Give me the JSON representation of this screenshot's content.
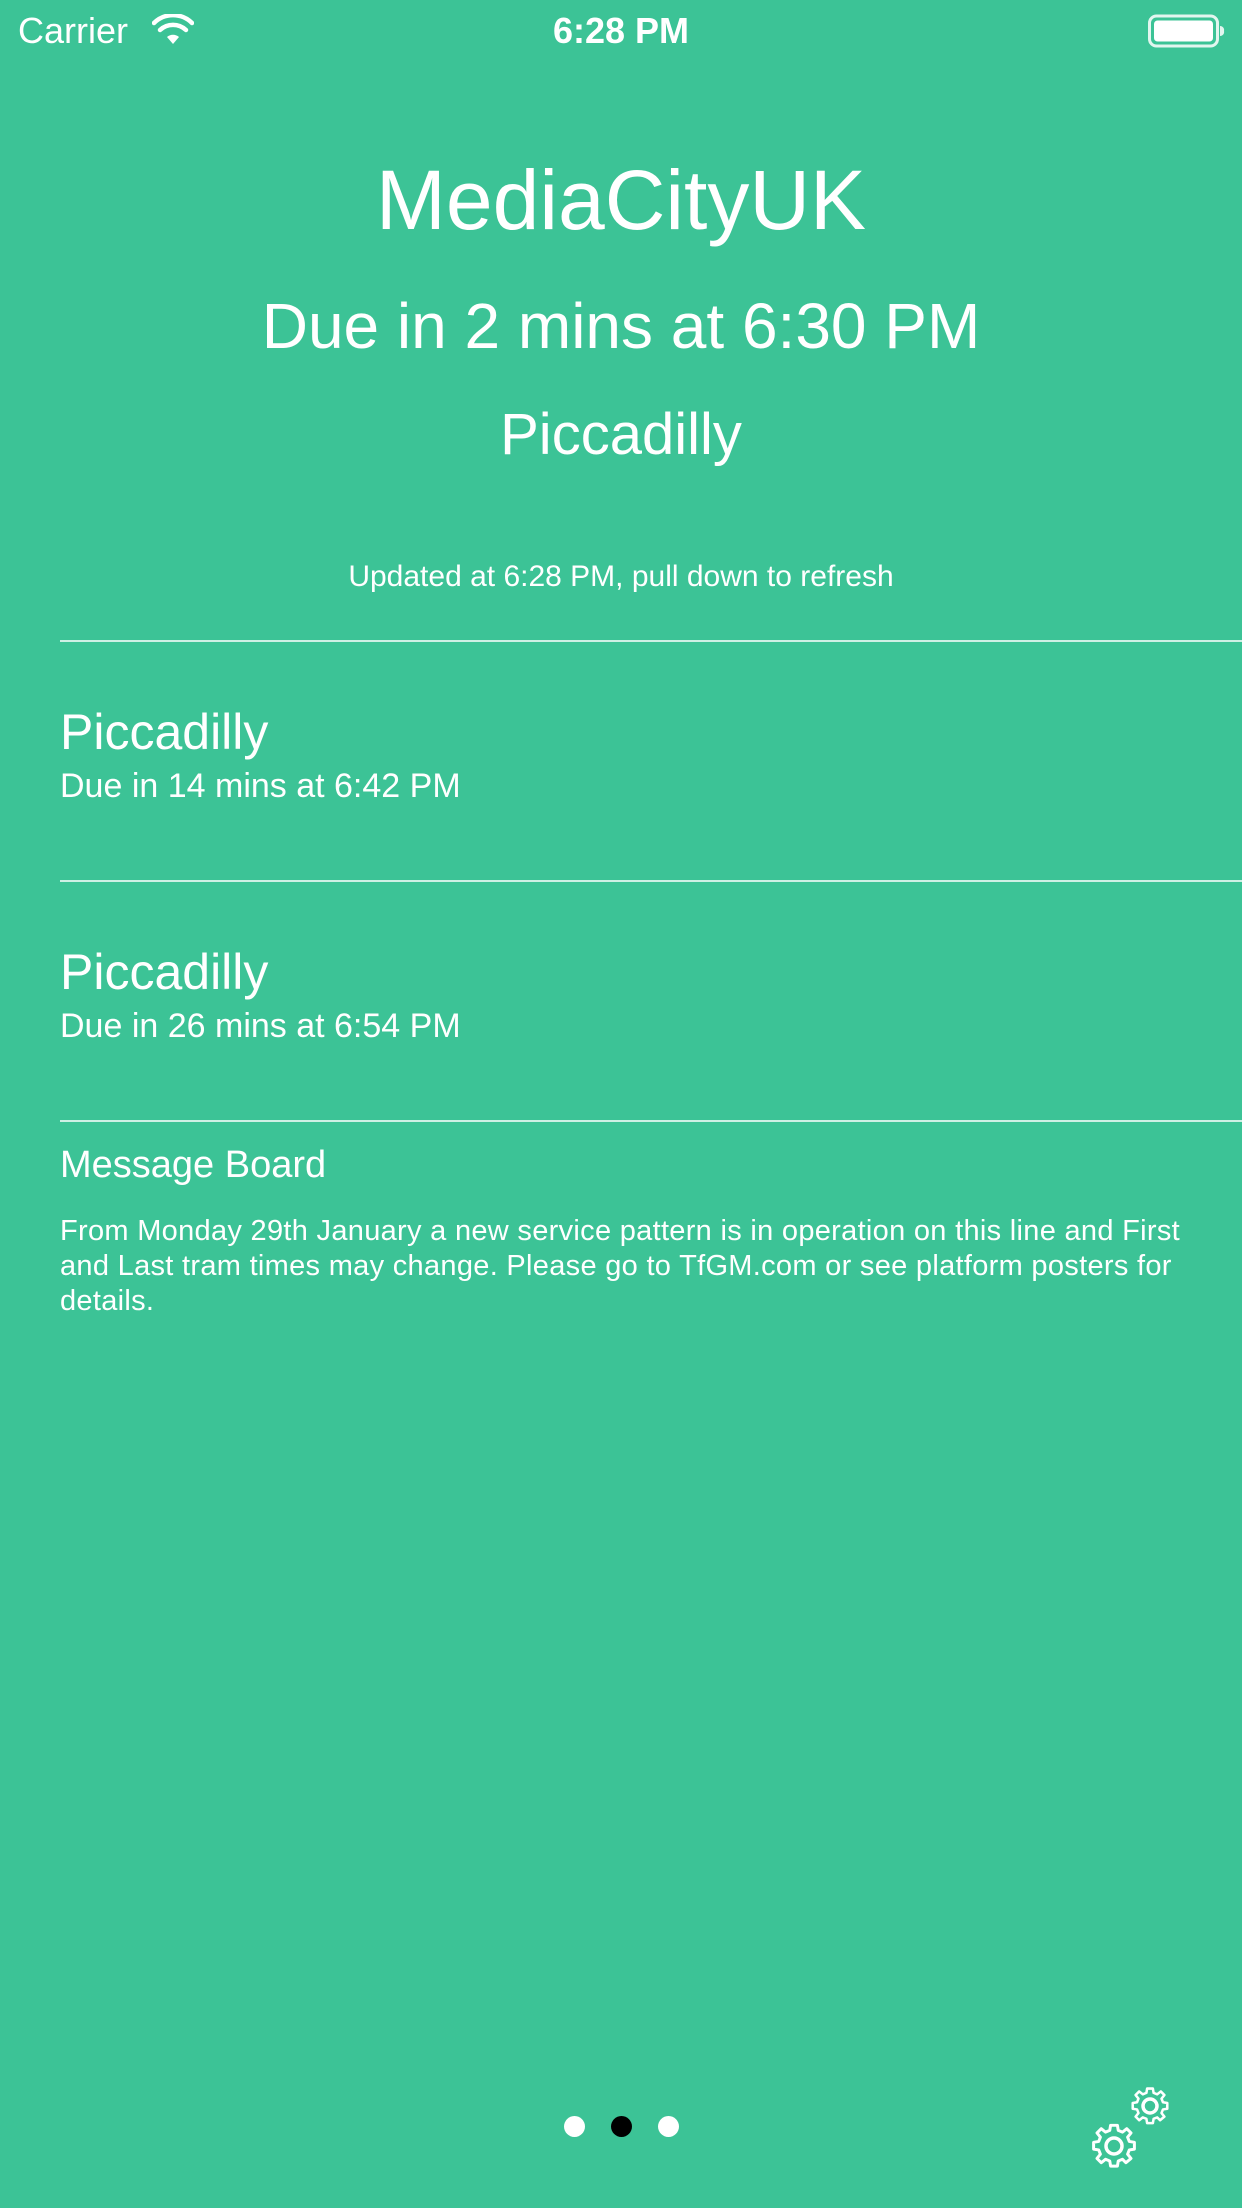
{
  "status_bar": {
    "carrier": "Carrier",
    "time": "6:28 PM"
  },
  "next_tram": {
    "station": "MediaCityUK",
    "due": "Due in 2 mins at 6:30 PM",
    "destination": "Piccadilly"
  },
  "updated_text": "Updated at 6:28 PM, pull down to refresh",
  "trams": [
    {
      "destination": "Piccadilly",
      "due": "Due in 14 mins at 6:42 PM"
    },
    {
      "destination": "Piccadilly",
      "due": "Due in 26 mins at 6:54 PM"
    }
  ],
  "message_board": {
    "title": "Message Board",
    "body": "From Monday 29th January a new service pattern is in operation on this line and First and Last tram times may change. Please go to TfGM.com or see platform posters for details."
  },
  "pager": {
    "page_count": 3,
    "current_page": 2
  },
  "colors": {
    "background": "#3cc396",
    "text": "#ffffff",
    "active_dot": "#000000"
  },
  "icons": {
    "wifi": "wifi-icon",
    "battery": "battery-icon",
    "settings": "gears-icon"
  }
}
